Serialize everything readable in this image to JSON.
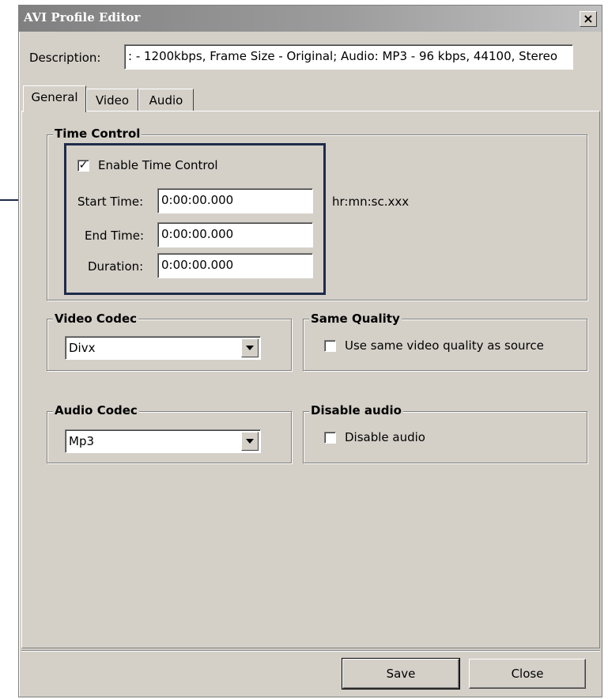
{
  "window": {
    "title": "AVI Profile Editor",
    "close_glyph": "×"
  },
  "description": {
    "label": "Description:",
    "value": ": - 1200kbps, Frame Size - Original; Audio: MP3 - 96 kbps, 44100, Stereo"
  },
  "tabs": [
    {
      "label": "General",
      "selected": true
    },
    {
      "label": "Video",
      "selected": false
    },
    {
      "label": "Audio",
      "selected": false
    }
  ],
  "time_control": {
    "legend": "Time Control",
    "enable_label": "Enable Time Control",
    "enable_checked": true,
    "check_glyph": "✓",
    "start_label": "Start Time:",
    "start_value": "0:00:00.000",
    "format_hint": "hr:mn:sc.xxx",
    "end_label": "End Time:",
    "end_value": "0:00:00.000",
    "duration_label": "Duration:",
    "duration_value": "0:00:00.000"
  },
  "video_codec": {
    "legend": "Video Codec",
    "selected": "Divx"
  },
  "same_quality": {
    "legend": "Same Quality",
    "label": "Use same video quality as source",
    "checked": false
  },
  "audio_codec": {
    "legend": "Audio Codec",
    "selected": "Mp3"
  },
  "disable_audio": {
    "legend": "Disable audio",
    "label": "Disable audio",
    "checked": false
  },
  "buttons": {
    "save": "Save",
    "close": "Close"
  },
  "colors": {
    "dialog_bg": "#d4d0c8",
    "highlight_border": "#1f2b4a"
  }
}
